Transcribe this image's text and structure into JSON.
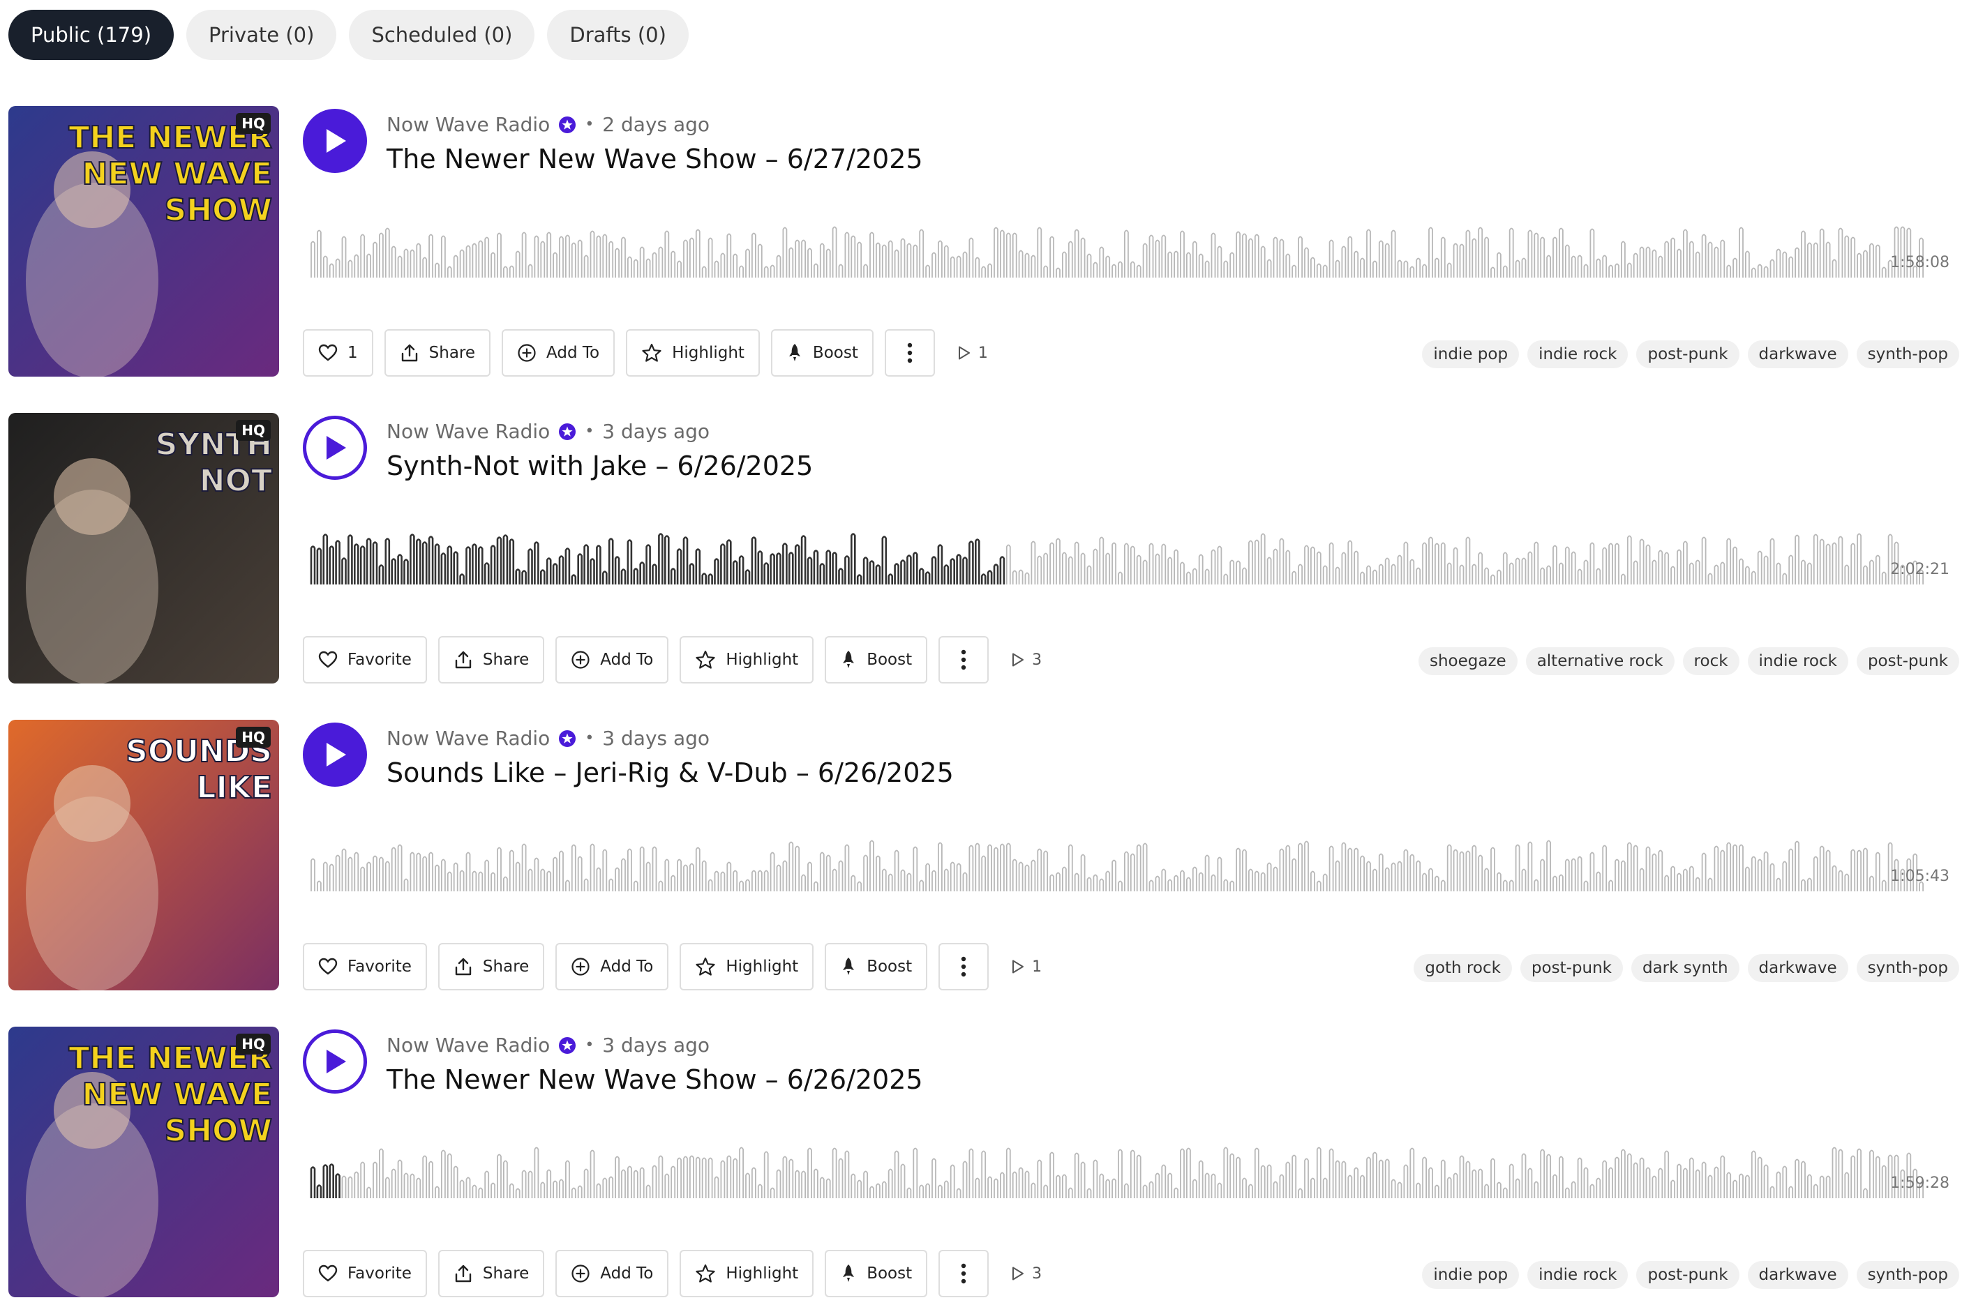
{
  "tabs": [
    {
      "label": "Public (179)",
      "active": true
    },
    {
      "label": "Private (0)"
    },
    {
      "label": "Scheduled (0)"
    },
    {
      "label": "Drafts (0)"
    }
  ],
  "colors": {
    "accent": "#4a1bd9",
    "active_tab": "#19202c"
  },
  "tracks": [
    {
      "art_label": "HQ",
      "channel": "Now Wave Radio",
      "age": "2 days ago",
      "title": "The Newer New Wave Show – 6/27/2025",
      "duration": "1:58:08",
      "favorite_label": "1",
      "share_label": "Share",
      "addto_label": "Add To",
      "highlight_label": "Highlight",
      "boost_label": "Boost",
      "plays": "1",
      "tags": [
        "indie pop",
        "indie rock",
        "post-punk",
        "darkwave",
        "synth-pop"
      ]
    },
    {
      "art_label": "HQ",
      "channel": "Now Wave Radio",
      "age": "3 days ago",
      "title": "Synth-Not with Jake – 6/26/2025",
      "duration": "2:02:21",
      "favorite_label": "Favorite",
      "share_label": "Share",
      "addto_label": "Add To",
      "highlight_label": "Highlight",
      "boost_label": "Boost",
      "plays": "3",
      "tags": [
        "shoegaze",
        "alternative rock",
        "rock",
        "indie rock",
        "post-punk"
      ]
    },
    {
      "art_label": "HQ",
      "channel": "Now Wave Radio",
      "age": "3 days ago",
      "title": "Sounds Like – Jeri-Rig & V-Dub – 6/26/2025",
      "duration": "1:05:43",
      "favorite_label": "Favorite",
      "share_label": "Share",
      "addto_label": "Add To",
      "highlight_label": "Highlight",
      "boost_label": "Boost",
      "plays": "1",
      "tags": [
        "goth rock",
        "post-punk",
        "dark synth",
        "darkwave",
        "synth-pop"
      ]
    },
    {
      "art_label": "HQ",
      "channel": "Now Wave Radio",
      "age": "3 days ago",
      "title": "The Newer New Wave Show – 6/26/2025",
      "duration": "1:59:28",
      "favorite_label": "Favorite",
      "share_label": "Share",
      "addto_label": "Add To",
      "highlight_label": "Highlight",
      "boost_label": "Boost",
      "plays": "3",
      "tags": [
        "indie pop",
        "indie rock",
        "post-punk",
        "darkwave",
        "synth-pop"
      ]
    }
  ]
}
